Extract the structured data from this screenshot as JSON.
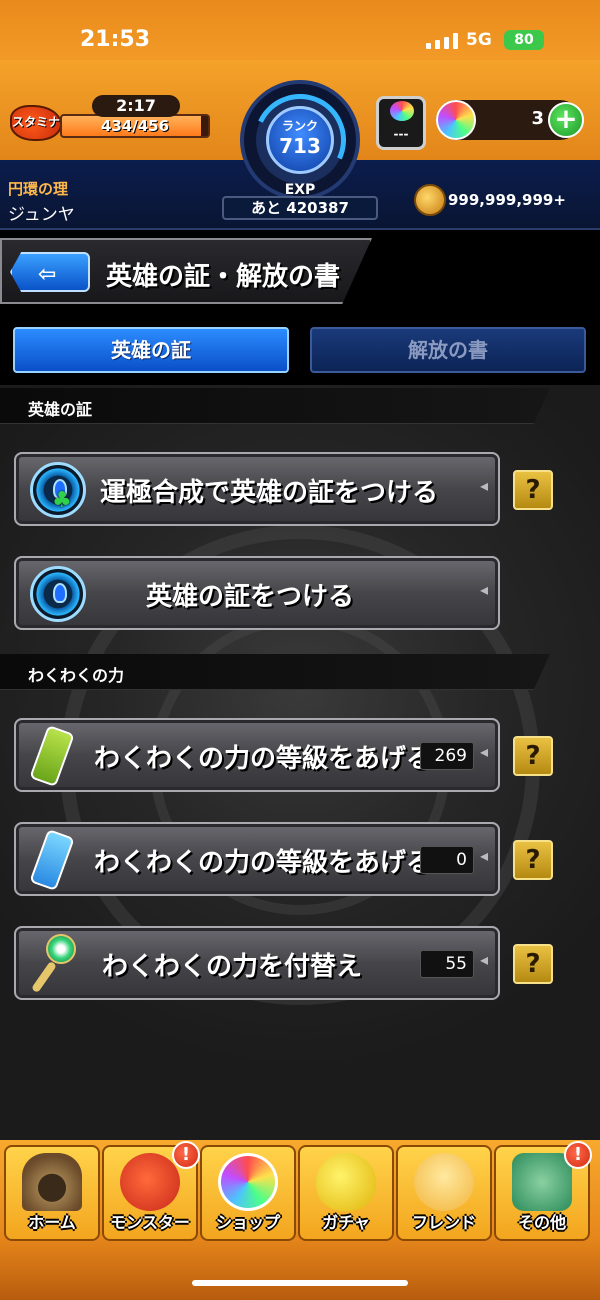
{
  "status_bar": {
    "time": "21:53",
    "network": "5G",
    "battery": "80"
  },
  "header": {
    "stamina_label": "スタミナ",
    "stamina_timer": "2:17",
    "stamina_value": "434/456",
    "stamina_fraction": 0.95,
    "rank_label": "ランク",
    "rank_value": "713",
    "exp_label": "EXP",
    "exp_remaining": "あと 420387",
    "slot_value": "---",
    "orb_count": "3",
    "plus_label": "+",
    "user_title": "円環の理",
    "user_name": "ジュンヤ",
    "coins": "999,999,999+"
  },
  "title_bar": {
    "back_icon": "⇦",
    "title": "英雄の証・解放の書"
  },
  "tabs": [
    {
      "label": "英雄の証",
      "active": true
    },
    {
      "label": "解放の書",
      "active": false
    }
  ],
  "sections": [
    {
      "label": "英雄の証"
    },
    {
      "label": "わくわくの力"
    }
  ],
  "menu_items": [
    {
      "label": "運極合成で英雄の証をつける",
      "icon": "blue-flame-clover-icon",
      "help": "?"
    },
    {
      "label": "英雄の証をつける",
      "icon": "blue-flame-icon"
    },
    {
      "label": "わくわくの力の等級をあげる",
      "icon": "green-bottle-icon",
      "count": "269",
      "help": "?"
    },
    {
      "label": "わくわくの力の等級をあげる",
      "icon": "blue-bottle-icon",
      "count": "0",
      "help": "?"
    },
    {
      "label": "わくわくの力を付替え",
      "icon": "wand-icon",
      "count": "55",
      "help": "?"
    }
  ],
  "bottom_nav": [
    {
      "label": "ホーム",
      "icon": "home-gate-icon"
    },
    {
      "label": "モンスター",
      "icon": "monster-icon",
      "alert": "!"
    },
    {
      "label": "ショップ",
      "icon": "orb-icon"
    },
    {
      "label": "ガチャ",
      "icon": "egg-icon"
    },
    {
      "label": "フレンド",
      "icon": "friends-icon"
    },
    {
      "label": "その他",
      "icon": "other-icon",
      "alert": "!"
    }
  ],
  "colors": {
    "accent_orange": "#f29a27",
    "tab_blue": "#2c8cff",
    "help_gold": "#e9c142"
  }
}
